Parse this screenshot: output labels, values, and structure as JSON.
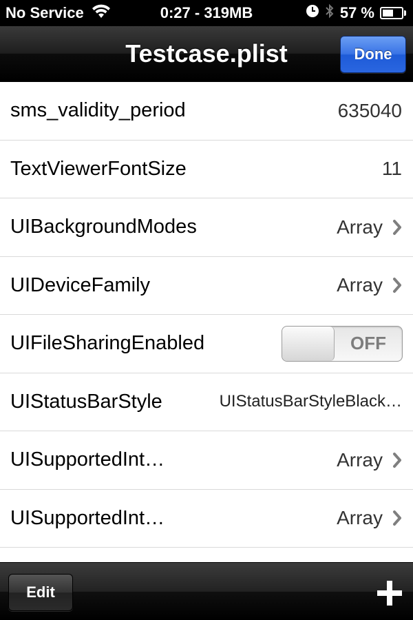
{
  "status_bar": {
    "carrier": "No Service",
    "time_memory": "0:27 - 319MB",
    "battery_percent": "57 %",
    "battery_level": 0.57,
    "icons": [
      "wifi-icon",
      "clock-icon",
      "bluetooth-icon",
      "battery-icon"
    ]
  },
  "nav_bar": {
    "title": "Testcase.plist",
    "done_label": "Done"
  },
  "rows": [
    {
      "key": "sms_validity_period",
      "value": "635040",
      "type": "number"
    },
    {
      "key": "TextViewerFontSize",
      "value": "11",
      "type": "number"
    },
    {
      "key": "UIBackgroundModes",
      "value": "Array",
      "type": "array"
    },
    {
      "key": "UIDeviceFamily",
      "value": "Array",
      "type": "array"
    },
    {
      "key": "UIFileSharingEnabled",
      "value": "OFF",
      "type": "boolean",
      "on": false
    },
    {
      "key": "UIStatusBarStyle",
      "value": "UIStatusBarStyleBlack…",
      "type": "string"
    },
    {
      "key": "UISupportedInt…",
      "value": "Array",
      "type": "array"
    },
    {
      "key": "UISupportedInt…",
      "value": "Array",
      "type": "array"
    }
  ],
  "toolbar": {
    "edit_label": "Edit",
    "add_icon": "plus-icon"
  },
  "colors": {
    "accent_blue": "#2a66e0",
    "bar_black": "#000000",
    "chevron_gray": "#7f7f7f"
  }
}
